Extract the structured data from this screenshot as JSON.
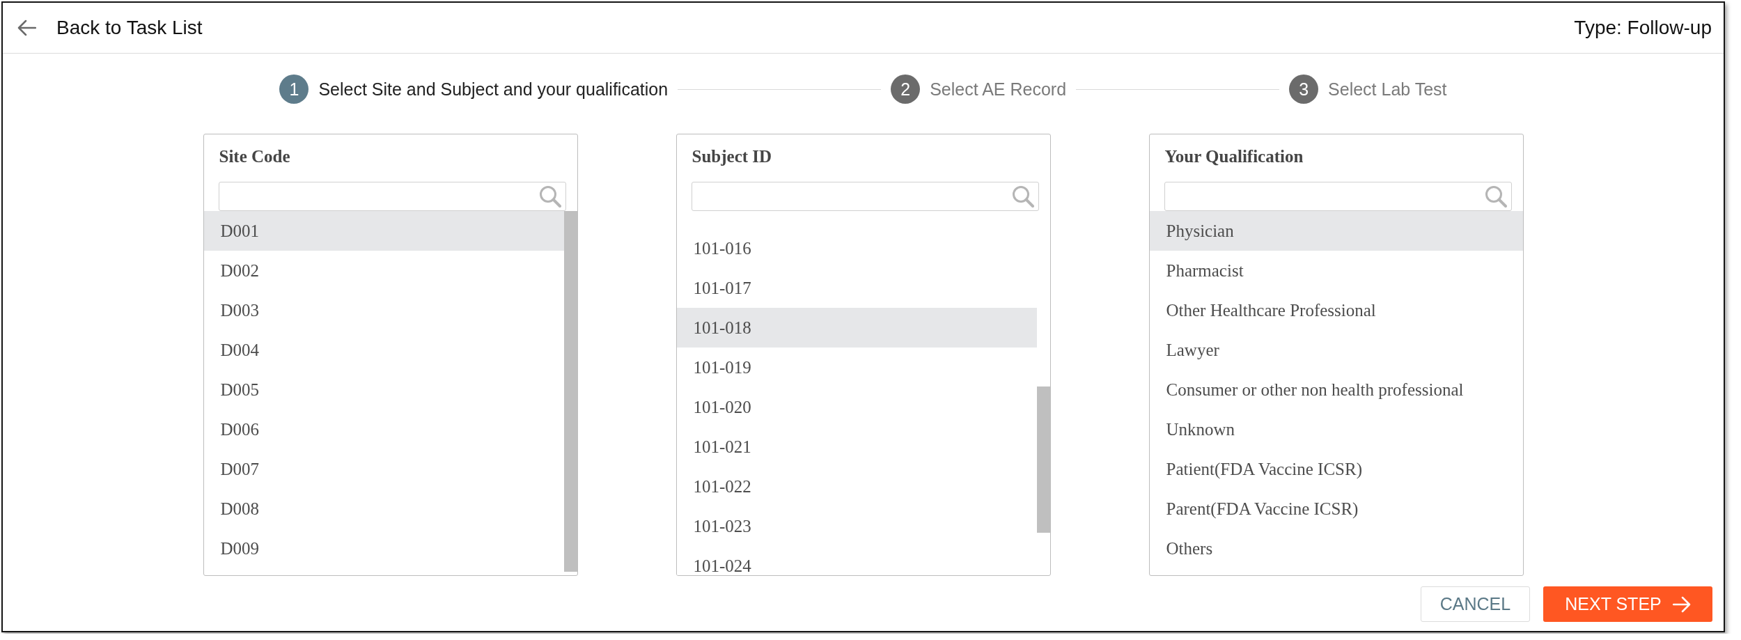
{
  "header": {
    "back_label": "Back to Task List",
    "type_label": "Type: Follow-up"
  },
  "steps": [
    {
      "number": "1",
      "label": "Select Site and Subject and your qualification",
      "active": true
    },
    {
      "number": "2",
      "label": "Select AE Record",
      "active": false
    },
    {
      "number": "3",
      "label": "Select Lab Test",
      "active": false
    }
  ],
  "panels": [
    {
      "title": "Site Code",
      "items": [
        {
          "label": "D001",
          "selected": true
        },
        {
          "label": "D002",
          "selected": false
        },
        {
          "label": "D003",
          "selected": false
        },
        {
          "label": "D004",
          "selected": false
        },
        {
          "label": "D005",
          "selected": false
        },
        {
          "label": "D006",
          "selected": false
        },
        {
          "label": "D007",
          "selected": false
        },
        {
          "label": "D008",
          "selected": false
        },
        {
          "label": "D009",
          "selected": false
        }
      ]
    },
    {
      "title": "Subject ID",
      "items": [
        {
          "label": "101-016",
          "selected": false
        },
        {
          "label": "101-017",
          "selected": false
        },
        {
          "label": "101-018",
          "selected": true
        },
        {
          "label": "101-019",
          "selected": false
        },
        {
          "label": "101-020",
          "selected": false
        },
        {
          "label": "101-021",
          "selected": false
        },
        {
          "label": "101-022",
          "selected": false
        },
        {
          "label": "101-023",
          "selected": false
        },
        {
          "label": "101-024",
          "selected": false
        }
      ]
    },
    {
      "title": "Your Qualification",
      "items": [
        {
          "label": "Physician",
          "selected": true
        },
        {
          "label": "Pharmacist",
          "selected": false
        },
        {
          "label": "Other Healthcare Professional",
          "selected": false
        },
        {
          "label": "Lawyer",
          "selected": false
        },
        {
          "label": "Consumer or other non health professional",
          "selected": false
        },
        {
          "label": "Unknown",
          "selected": false
        },
        {
          "label": "Patient(FDA Vaccine ICSR)",
          "selected": false
        },
        {
          "label": "Parent(FDA Vaccine ICSR)",
          "selected": false
        },
        {
          "label": "Others",
          "selected": false
        }
      ]
    }
  ],
  "buttons": [
    {
      "label": "CANCEL",
      "kind": "cancel"
    },
    {
      "label": "NEXT STEP",
      "kind": "next"
    }
  ]
}
